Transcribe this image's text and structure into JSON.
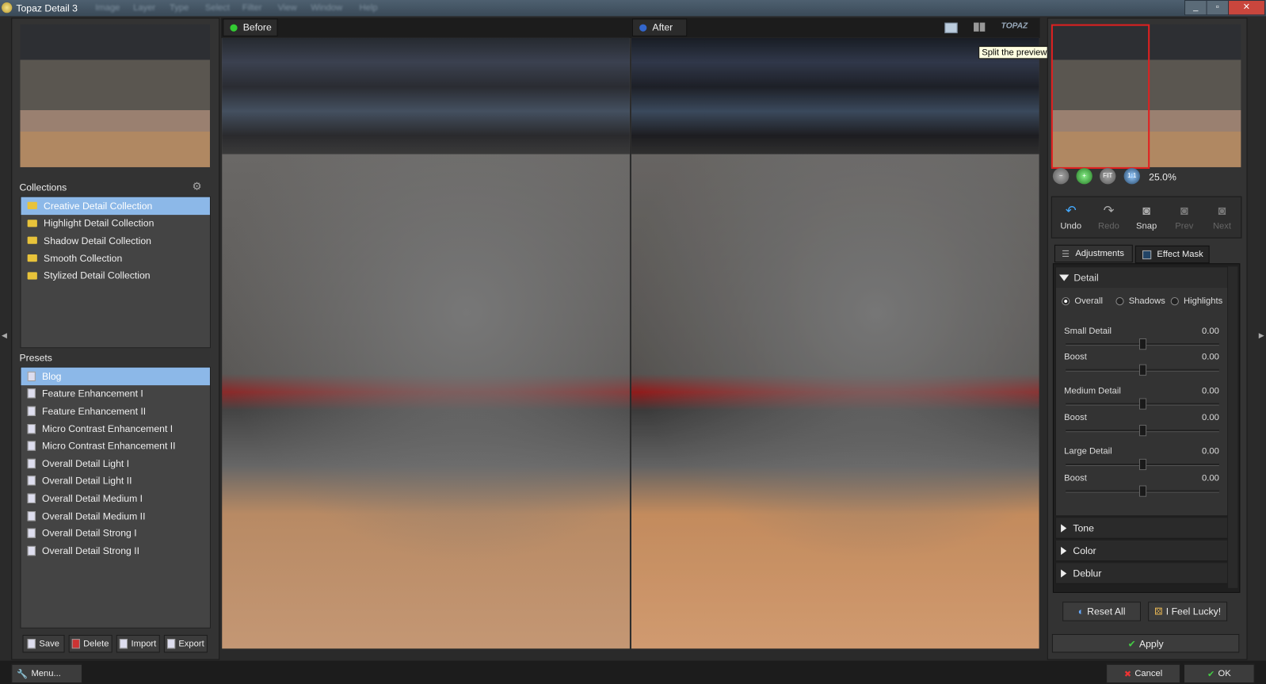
{
  "window": {
    "title": "Topaz Detail 3",
    "menu_items": [
      "Image",
      "Layer",
      "Type",
      "Select",
      "Filter",
      "View",
      "Window",
      "Help"
    ]
  },
  "collections": {
    "header": "Collections",
    "items": [
      "Creative Detail Collection",
      "Highlight Detail Collection",
      "Shadow Detail Collection",
      "Smooth Collection",
      "Stylized Detail Collection"
    ],
    "selected": 0
  },
  "presets": {
    "header": "Presets",
    "items": [
      "Blog",
      "Feature Enhancement I",
      "Feature Enhancement II",
      "Micro Contrast Enhancement I",
      "Micro Contrast Enhancement II",
      "Overall Detail Light I",
      "Overall Detail Light II",
      "Overall Detail Medium I",
      "Overall Detail Medium II",
      "Overall Detail Strong I",
      "Overall Detail Strong II"
    ],
    "selected": 0
  },
  "preset_buttons": {
    "save": "Save",
    "delete": "Delete",
    "import": "Import",
    "export": "Export"
  },
  "preview": {
    "before_label": "Before",
    "after_label": "After",
    "tooltip": "Split the preview to two side-by-side views."
  },
  "zoom": {
    "value": "25.0%",
    "fit": "FIT",
    "one_to_one": "1:1"
  },
  "tools": {
    "undo": "Undo",
    "redo": "Redo",
    "snap": "Snap",
    "prev": "Prev",
    "next": "Next"
  },
  "tabs": {
    "adjustments": "Adjustments",
    "effect_mask": "Effect Mask"
  },
  "detail": {
    "header": "Detail",
    "radios": [
      "Overall",
      "Shadows",
      "Highlights"
    ],
    "radio_selected": 0,
    "sliders": [
      {
        "label": "Small Detail",
        "value": "0.00"
      },
      {
        "label": "Boost",
        "value": "0.00"
      },
      {
        "label": "Medium Detail",
        "value": "0.00"
      },
      {
        "label": "Boost",
        "value": "0.00"
      },
      {
        "label": "Large Detail",
        "value": "0.00"
      },
      {
        "label": "Boost",
        "value": "0.00"
      }
    ]
  },
  "sections": [
    "Tone",
    "Color",
    "Deblur"
  ],
  "actions": {
    "reset_all": "Reset All",
    "feel_lucky": "I Feel Lucky!",
    "apply": "Apply"
  },
  "footer": {
    "menu": "Menu...",
    "cancel": "Cancel",
    "ok": "OK"
  }
}
